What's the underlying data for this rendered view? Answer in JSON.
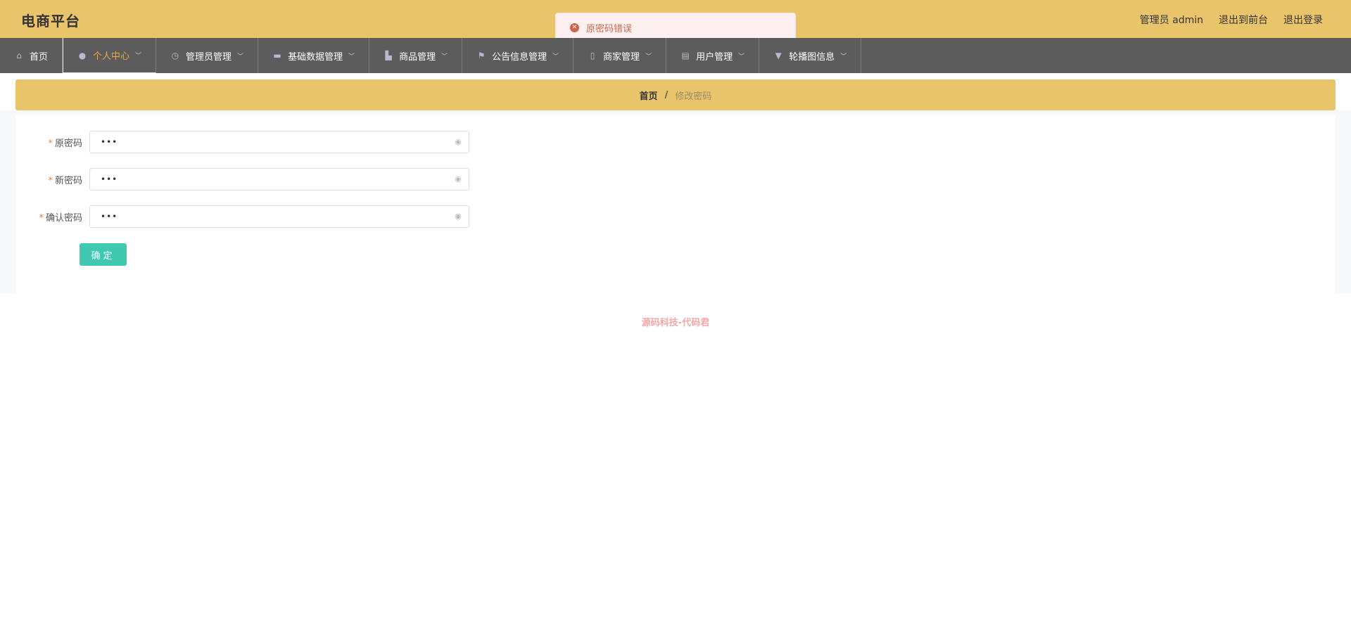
{
  "header": {
    "brand": "电商平台",
    "admin_label": "管理员 admin",
    "to_front_label": "退出到前台",
    "logout_label": "退出登录"
  },
  "toast": {
    "message": "原密码错误",
    "icon": "error-circle-icon",
    "color": "#c96a4c"
  },
  "nav": {
    "items": [
      {
        "label": "首页",
        "icon": "home-icon"
      },
      {
        "label": "个人中心",
        "icon": "user-icon"
      },
      {
        "label": "管理员管理",
        "icon": "clock-icon"
      },
      {
        "label": "基础数据管理",
        "icon": "monitor-icon"
      },
      {
        "label": "商品管理",
        "icon": "thumb-icon"
      },
      {
        "label": "公告信息管理",
        "icon": "flag-icon"
      },
      {
        "label": "商家管理",
        "icon": "phone-icon"
      },
      {
        "label": "用户管理",
        "icon": "briefcase-icon"
      },
      {
        "label": "轮播图信息",
        "icon": "pin-icon"
      }
    ]
  },
  "breadcrumb": {
    "home": "首页",
    "separator": "/",
    "current": "修改密码"
  },
  "form": {
    "fields": [
      {
        "label": "原密码",
        "value": "•••"
      },
      {
        "label": "新密码",
        "value": "•••"
      },
      {
        "label": "确认密码",
        "value": "•••"
      }
    ],
    "required_mark": "*",
    "submit_label": "确定"
  },
  "footer": {
    "text": "源码科技-代码君"
  },
  "colors": {
    "header_bg": "#e9c46a",
    "nav_bg": "#5c5c5c",
    "accent": "#3ec9b0",
    "active_nav": "#e9a94a"
  }
}
